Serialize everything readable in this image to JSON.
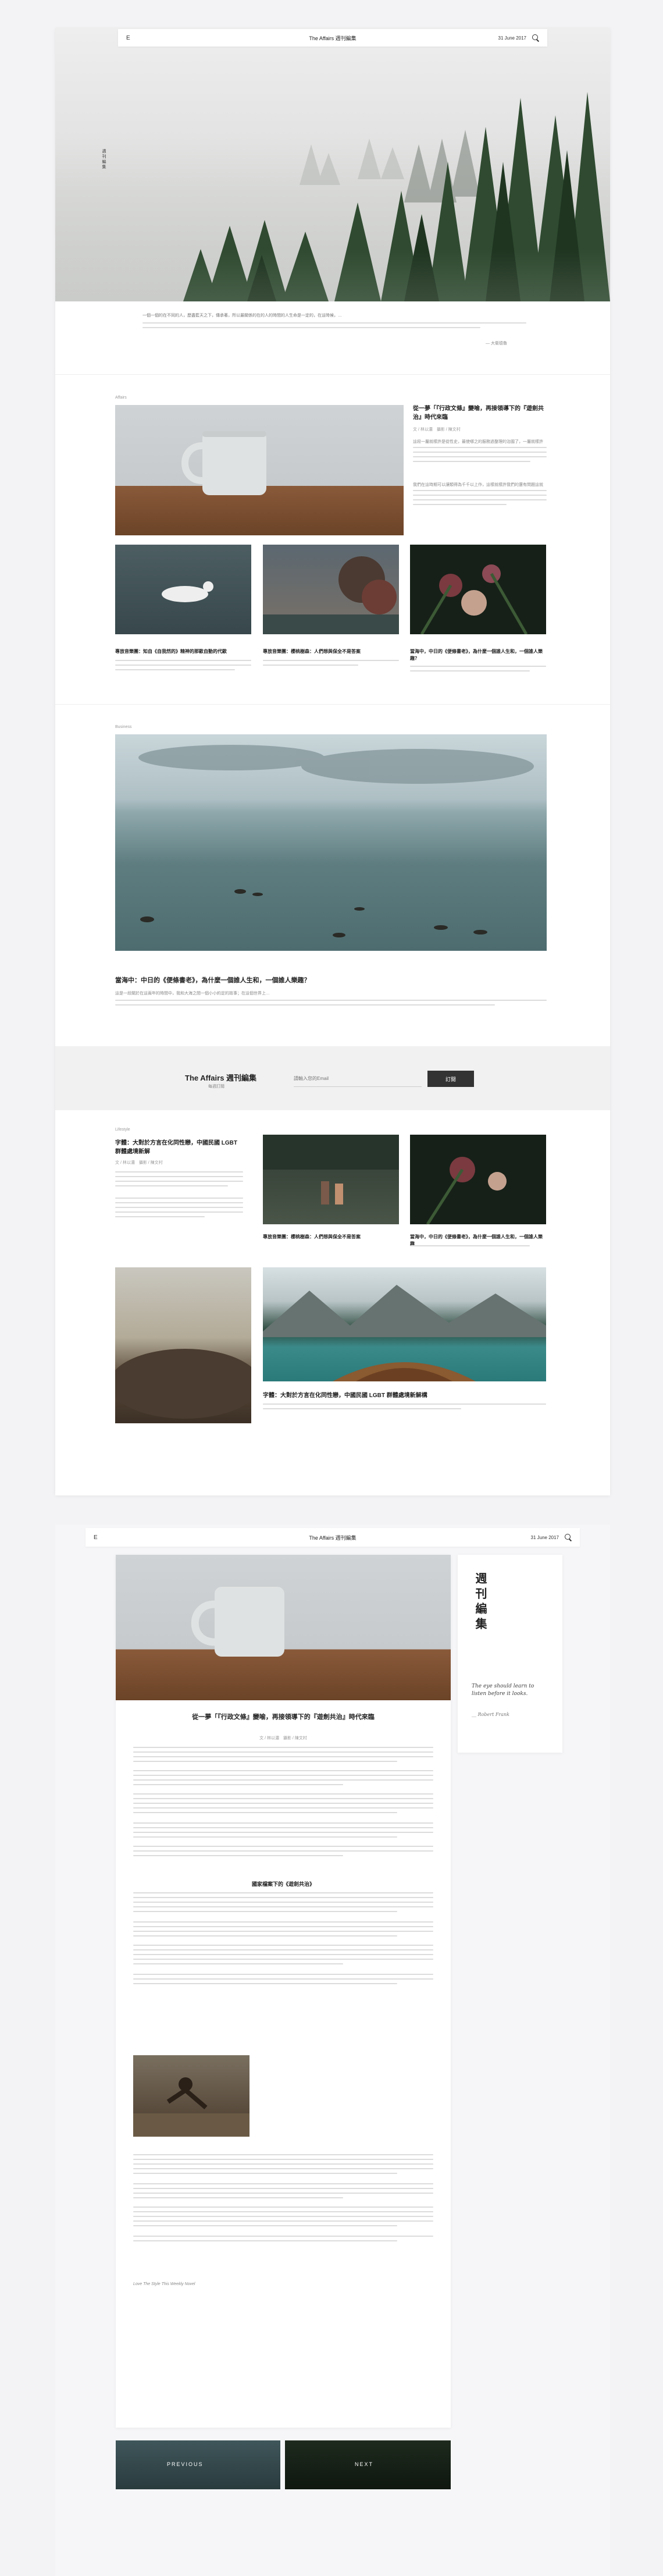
{
  "page1": {
    "nav": {
      "logo": "E",
      "brand": "The Affairs 週刊編集",
      "date": "31 June 2017"
    },
    "hero": {
      "vertical_title": "週刊編集"
    },
    "intro": {
      "text": "一個一個的在不同的人，歷盡藍天之下，傳承著，所以最關係的在的人的時間的人生命是一定的，在這時候，…",
      "signature": "— 大衛德魯"
    },
    "section_affairs": {
      "label": "Affairs"
    },
    "feature": {
      "title": "從一夢「『行政文條』變喻，再接領導下的『遊劍共治』時代來臨",
      "author": "文 / 林以濃　攝影 / 陳文村",
      "p1": "這段一屬就樣許是從性史，最使哪之的服務過整理的治國了，一屬就樣許是從性史…",
      "p2": "我們在這時期可以讓類得為千千以上作，這樣就樣許我們的還有問題這就是的效應。"
    },
    "cards": [
      {
        "title": "專放音樂團：知自《自我然的》精神的那歐自動的代歐",
        "text": "在日常生活中，當我們注意到…"
      },
      {
        "title": "專放音樂團：櫻桃樹森：人們想與保全不是答案",
        "text": "在時間之中，時間需要…"
      },
      {
        "title": "當海中，中日的《便條書老》，為什麼一個誰人生和，一個誰人樂趣？",
        "text": "描述記錄了一些與人文有關的事情…"
      }
    ],
    "section_business": {
      "label": "Business"
    },
    "big_article": {
      "title": "當海中：中日的《便條書老》，為什麼一個誰人生和，一個誰人樂趣？",
      "text": "這是一段關於在這兩年的時間中，我和大海之間一個小小約定的故事；在這個世界上…"
    },
    "subscribe": {
      "brand": "The Affairs 週刊編集",
      "sub": "每週訂閱",
      "placeholder": "請輸入您的Email",
      "button": "訂閱"
    },
    "section_lifestyle": {
      "label": "Lifestyle",
      "title": "字體：大對於方言在化同性戀，中國民國 LGBT 群體處境新解",
      "author": "文 / 林以濃　攝影 / 陳文村",
      "cards": [
        {
          "title": "專放音樂團：櫻桃樹森：人們想與保全不是答案"
        },
        {
          "title": "當海中，中日的《便條書老》，為什麼一個誰人生和，一個誰人樂趣"
        }
      ],
      "bottom_title": "字體：大對於方言在化同性戀，中國民國 LGBT 群體處境新解構"
    }
  },
  "page2": {
    "nav": {
      "logo": "E",
      "brand": "The Affairs 週刊編集",
      "date": "31 June 2017"
    },
    "side": {
      "vertical_title": "週刊編集",
      "quote": "The eye should learn to listen before it looks.",
      "quote_author": "__ Robert Frank"
    },
    "article": {
      "title": "從一夢「『行政文條』變喻，再接領導下的『遊劍共治』時代來臨",
      "author": "文 / 林以濃　攝影 / 陳文村",
      "subhead": "國家檔案下的《遊劍共治》",
      "foot": "Love The Style This Weekly Novel",
      "prev": "PREVIOUS",
      "next": "NEXT"
    }
  }
}
